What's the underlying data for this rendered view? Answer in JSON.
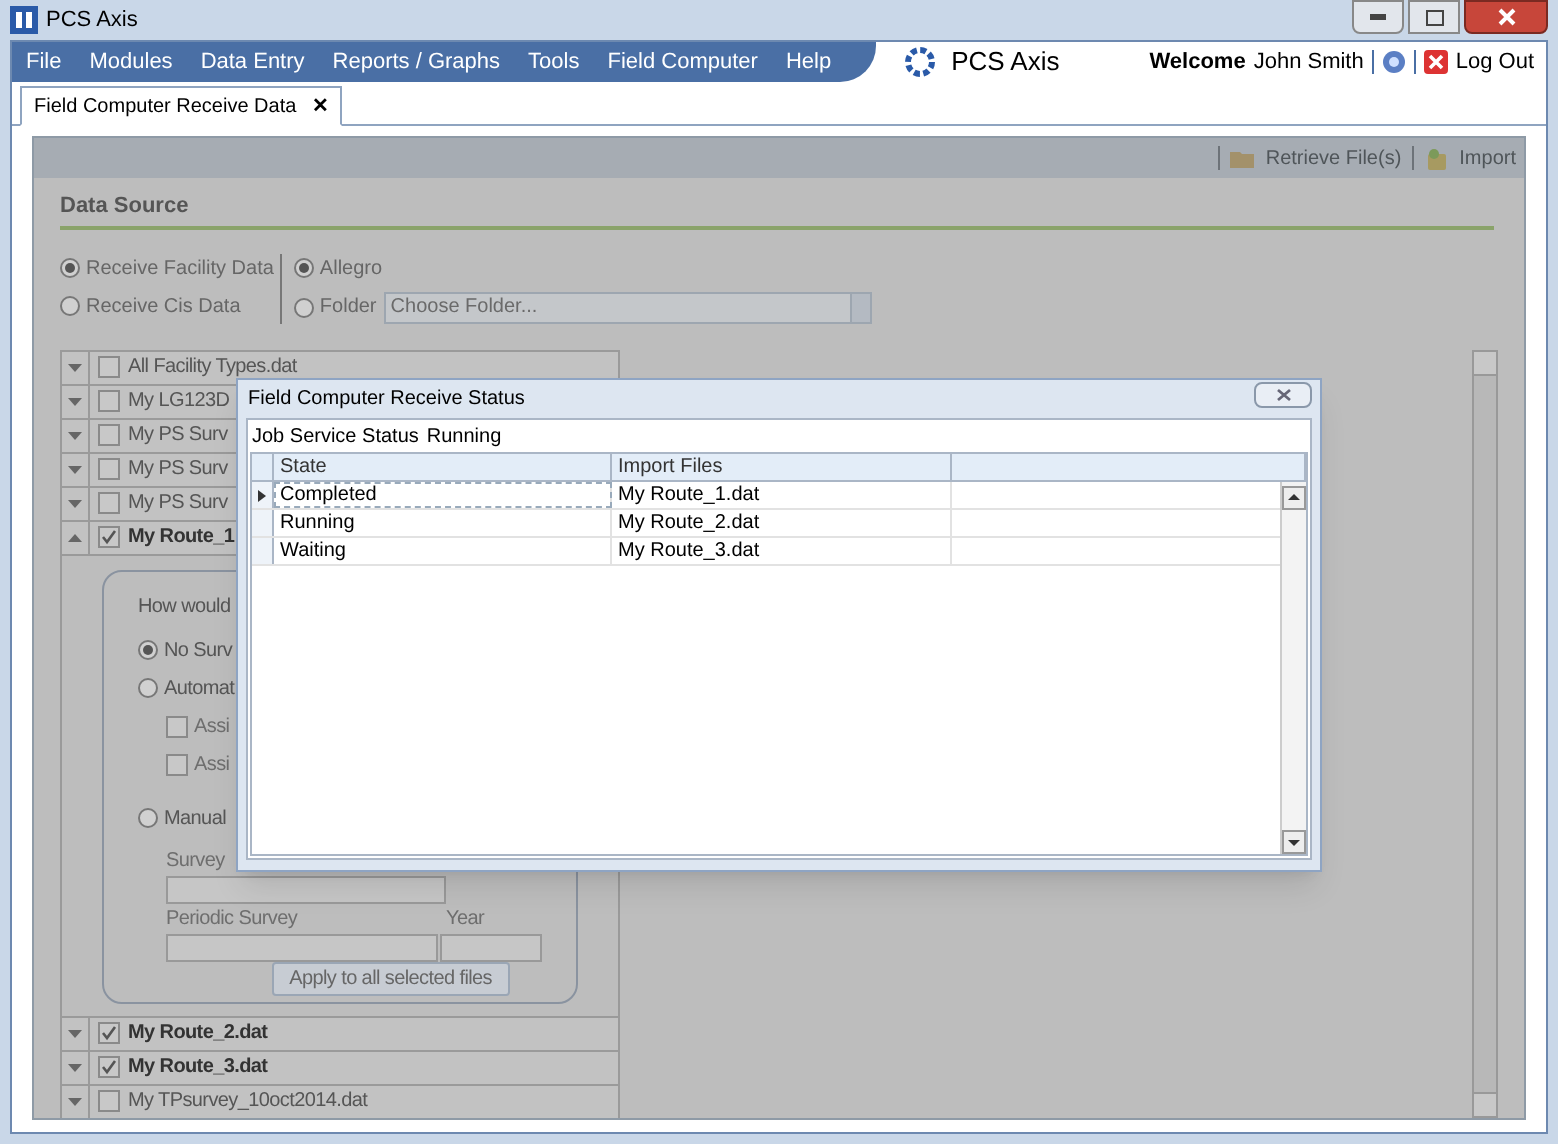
{
  "window": {
    "title": "PCS Axis"
  },
  "menu": [
    "File",
    "Modules",
    "Data Entry",
    "Reports / Graphs",
    "Tools",
    "Field Computer",
    "Help"
  ],
  "brand": "PCS Axis",
  "user": {
    "welcome": "Welcome",
    "name": "John Smith",
    "logout": "Log Out"
  },
  "tabs": [
    {
      "label": "Field Computer Receive Data",
      "selected": true,
      "close": "✕"
    }
  ],
  "toolbar": [
    "Retrieve File(s)",
    "Import"
  ],
  "section_title": "Data Source",
  "data_type": [
    {
      "label": "Receive Facility Data",
      "selected": true
    },
    {
      "label": "Receive Cis Data",
      "selected": false
    }
  ],
  "source": [
    {
      "label": "Allegro",
      "selected": true
    },
    {
      "label": "Folder",
      "selected": false
    }
  ],
  "folder_field": {
    "placeholder": "Choose Folder..."
  },
  "files": [
    {
      "label": "All Facility Types.dat",
      "checked": false,
      "expanded": false
    },
    {
      "label": "My LG123D",
      "checked": false,
      "expanded": false
    },
    {
      "label": "My PS Surv",
      "checked": false,
      "expanded": false
    },
    {
      "label": "My PS Surv",
      "checked": false,
      "expanded": false
    },
    {
      "label": "My PS Surv",
      "checked": false,
      "expanded": false
    },
    {
      "label": "My Route_1",
      "checked": true,
      "expanded": true
    },
    {
      "label": "My Route_2.dat",
      "checked": true,
      "expanded": false
    },
    {
      "label": "My Route_3.dat",
      "checked": true,
      "expanded": false
    },
    {
      "label": "My TPsurvey_10oct2014.dat",
      "checked": false,
      "expanded": false
    }
  ],
  "detail": {
    "question": "How would",
    "options": [
      {
        "kind": "radio",
        "label": "No Surv",
        "selected": true
      },
      {
        "kind": "radio",
        "label": "Automat",
        "selected": false
      },
      {
        "kind": "check",
        "label": "Assi",
        "checked": false
      },
      {
        "kind": "check",
        "label": "Assi",
        "checked": false
      },
      {
        "kind": "radio",
        "label": "Manual",
        "selected": false
      }
    ],
    "survey_label": "Survey",
    "periodic_label": "Periodic Survey",
    "year_label": "Year",
    "apply": "Apply to all selected files"
  },
  "dialog": {
    "title": "Field Computer Receive Status",
    "status_label": "Job Service Status",
    "status": "Running",
    "columns": [
      "State",
      "Import Files"
    ],
    "rows": [
      {
        "state": "Completed",
        "file": "My Route_1.dat",
        "selected": true
      },
      {
        "state": "Running",
        "file": "My Route_2.dat",
        "selected": false
      },
      {
        "state": "Waiting",
        "file": "My Route_3.dat",
        "selected": false
      }
    ]
  }
}
